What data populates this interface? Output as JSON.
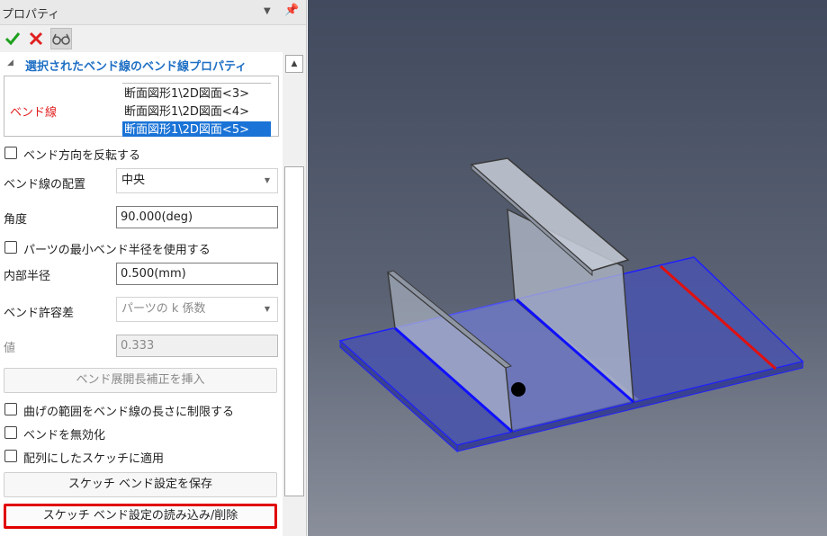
{
  "panel": {
    "title": "プロパティ",
    "icons": {
      "dropdown": "dropdown-arrow-icon",
      "pin": "pin-icon"
    }
  },
  "toolbar": {
    "ok": "checkmark-icon",
    "cancel": "cross-icon",
    "preview": "glasses-icon"
  },
  "section": {
    "title": "選択されたベンド線のベンド線プロパティ"
  },
  "bendlines": {
    "label": "ベンド線",
    "items": [
      "断面図形1\\2D図面<3>",
      "断面図形1\\2D図面<4>",
      "断面図形1\\2D図面<5>"
    ],
    "selected_index": 2
  },
  "form": {
    "reverse_direction": "ベンド方向を反転する",
    "placement_label": "ベンド線の配置",
    "placement_value": "中央",
    "angle_label": "角度",
    "angle_value": "90.000(deg)",
    "use_min_radius": "パーツの最小ベンド半径を使用する",
    "inner_radius_label": "内部半径",
    "inner_radius_value": "0.500(mm)",
    "allowance_label": "ベンド許容差",
    "allowance_value": "パーツの k 係数",
    "value_label": "値",
    "value_value": "0.333",
    "insert_button": "ベンド展開長補正を挿入",
    "limit_range": "曲げの範囲をベンド線の長さに制限する",
    "disable_bend": "ベンドを無効化",
    "apply_pattern": "配列にしたスケッチに適用",
    "save_button": "スケッチ ベンド設定を保存",
    "load_button": "スケッチ ベンド設定の読み込み/削除"
  },
  "viewport": {
    "colors": {
      "plate": "#4a55a8",
      "bend_line": "#1010ff",
      "highlight_line": "#e01010",
      "flange": "#a8b0c0"
    }
  }
}
